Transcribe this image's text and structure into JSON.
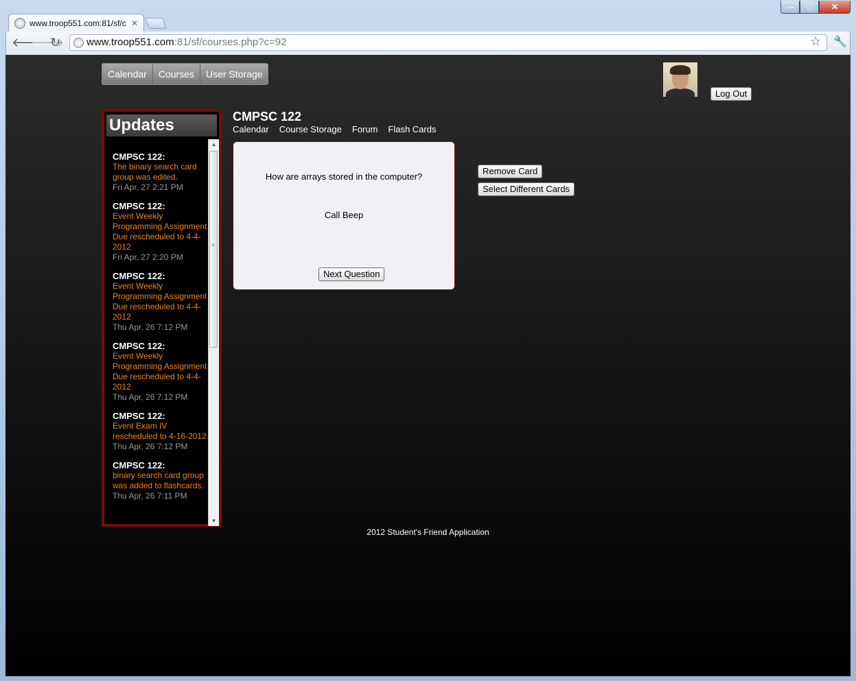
{
  "browser": {
    "tab_title": "www.troop551.com:81/sf/c",
    "url_host": "www.troop551.com",
    "url_rest": ":81/sf/courses.php?c=92"
  },
  "nav": {
    "items": [
      "Calendar",
      "Courses",
      "User Storage"
    ]
  },
  "account": {
    "logout_label": "Log Out"
  },
  "sidebar": {
    "title": "Updates",
    "updates": [
      {
        "course": "CMPSC 122:",
        "message": "The binary search card group was edited.",
        "date": "Fri Apr, 27 2:21 PM"
      },
      {
        "course": "CMPSC 122:",
        "message": "Event Weekly Programming Assignment Due rescheduled to 4-4-2012",
        "date": "Fri Apr, 27 2:20 PM"
      },
      {
        "course": "CMPSC 122:",
        "message": "Event Weekly Programming Assignment Due rescheduled to 4-4-2012",
        "date": "Thu Apr, 26 7:12 PM"
      },
      {
        "course": "CMPSC 122:",
        "message": "Event Weekly Programming Assignment Due rescheduled to 4-4-2012",
        "date": "Thu Apr, 26 7:12 PM"
      },
      {
        "course": "CMPSC 122:",
        "message": "Event Exam IV rescheduled to 4-16-2012",
        "date": "Thu Apr, 26 7:12 PM"
      },
      {
        "course": "CMPSC 122:",
        "message": "binary search card group was added to flashcards.",
        "date": "Thu Apr, 26 7:11 PM"
      }
    ]
  },
  "course": {
    "title": "CMPSC 122",
    "subnav": [
      "Calendar",
      "Course Storage",
      "Forum",
      "Flash Cards"
    ]
  },
  "flashcard": {
    "question": "How are arrays stored in the computer?",
    "answer": "Call Beep",
    "next_label": "Next Question"
  },
  "actions": {
    "remove_label": "Remove Card",
    "select_label": "Select Different Cards"
  },
  "footer": {
    "text": "2012 Student's Friend Application"
  }
}
